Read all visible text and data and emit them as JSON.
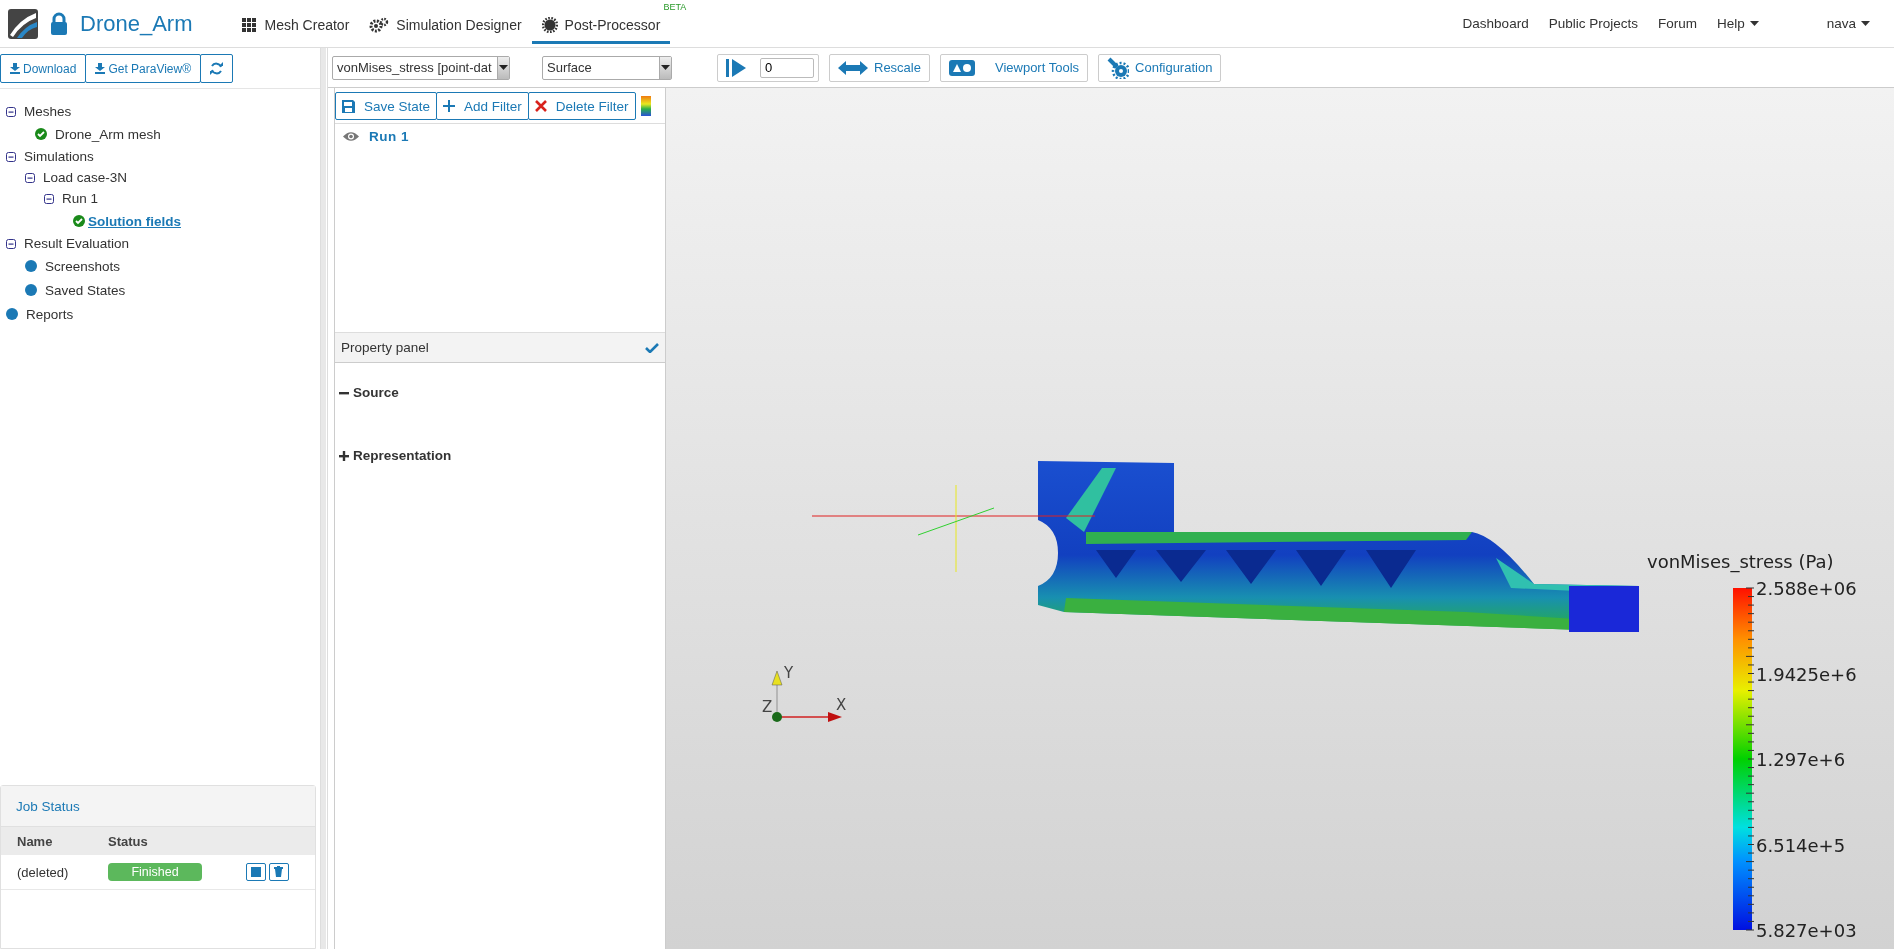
{
  "app": {
    "project": "Drone_Arm"
  },
  "nav_tabs": [
    {
      "label": "Mesh Creator",
      "kind": "grid",
      "selected": false
    },
    {
      "label": "Simulation Designer",
      "kind": "gears",
      "selected": false
    },
    {
      "label": "Post-Processor",
      "kind": "gear",
      "selected": true,
      "badge": "BETA"
    }
  ],
  "top_links": [
    {
      "label": "Dashboard",
      "kind": "link"
    },
    {
      "label": "Public Projects",
      "kind": "link"
    },
    {
      "label": "Forum",
      "kind": "link"
    },
    {
      "label": "Help",
      "kind": "dropdown"
    }
  ],
  "user": {
    "name": "nava"
  },
  "sidebar": {
    "buttons": [
      {
        "label": "Download",
        "kind": "download"
      },
      {
        "label": "Get ParaView®",
        "kind": "download"
      },
      {
        "kind": "refresh"
      }
    ],
    "tree": [
      {
        "label": "Meshes",
        "kind": "folder",
        "expanded": true,
        "selected": false,
        "children": [
          {
            "label": "Drone_Arm mesh",
            "kind": "done",
            "selected": false
          }
        ]
      },
      {
        "label": "Simulations",
        "kind": "folder",
        "expanded": true,
        "selected": false,
        "children": [
          {
            "label": "Load case-3N",
            "kind": "folder",
            "expanded": true,
            "selected": false,
            "children": [
              {
                "label": "Run 1",
                "kind": "folder",
                "expanded": true,
                "selected": false,
                "children": [
                  {
                    "label": "Solution fields",
                    "kind": "done",
                    "selected": true
                  }
                ]
              }
            ]
          }
        ]
      },
      {
        "label": "Result Evaluation",
        "kind": "folder",
        "expanded": true,
        "selected": false,
        "children": [
          {
            "label": "Screenshots",
            "kind": "item",
            "selected": false
          },
          {
            "label": "Saved States",
            "kind": "item",
            "selected": false
          }
        ]
      },
      {
        "label": "Reports",
        "kind": "item",
        "selected": false
      }
    ]
  },
  "job_status": {
    "title": "Job Status",
    "columns": [
      "Name",
      "Status"
    ],
    "rows": [
      {
        "name": "(deleted)",
        "status": "Finished",
        "kind": "success"
      }
    ]
  },
  "viewer_toolbar": {
    "field_select": {
      "value": "vonMises_stress [point-dat"
    },
    "representation_select": {
      "value": "Surface"
    },
    "time_field": {
      "value": "0"
    },
    "buttons": [
      {
        "label": "Rescale",
        "kind": "rescale"
      },
      {
        "label": "Viewport Tools",
        "kind": "viewport"
      },
      {
        "label": "Configuration",
        "kind": "config"
      }
    ]
  },
  "pipeline": {
    "buttons": [
      {
        "label": "Save State",
        "kind": "save"
      },
      {
        "label": "Add Filter",
        "kind": "add"
      },
      {
        "label": "Delete Filter",
        "kind": "delete"
      }
    ],
    "items": [
      {
        "label": "Run 1",
        "visible": true
      }
    ]
  },
  "property_panel": {
    "title": "Property panel",
    "sections": [
      {
        "label": "Source",
        "expanded": true
      },
      {
        "label": "Representation",
        "expanded": false
      }
    ]
  },
  "viewport": {
    "legend": {
      "title": "vonMises_stress (Pa)",
      "labels": [
        "2.588e+06",
        "1.9425e+6",
        "1.297e+6",
        "6.514e+5",
        "5.827e+03"
      ]
    },
    "axes": [
      {
        "label": "Y",
        "kind": "y"
      },
      {
        "label": "Z",
        "kind": "z"
      },
      {
        "label": "X",
        "kind": "x"
      }
    ]
  }
}
